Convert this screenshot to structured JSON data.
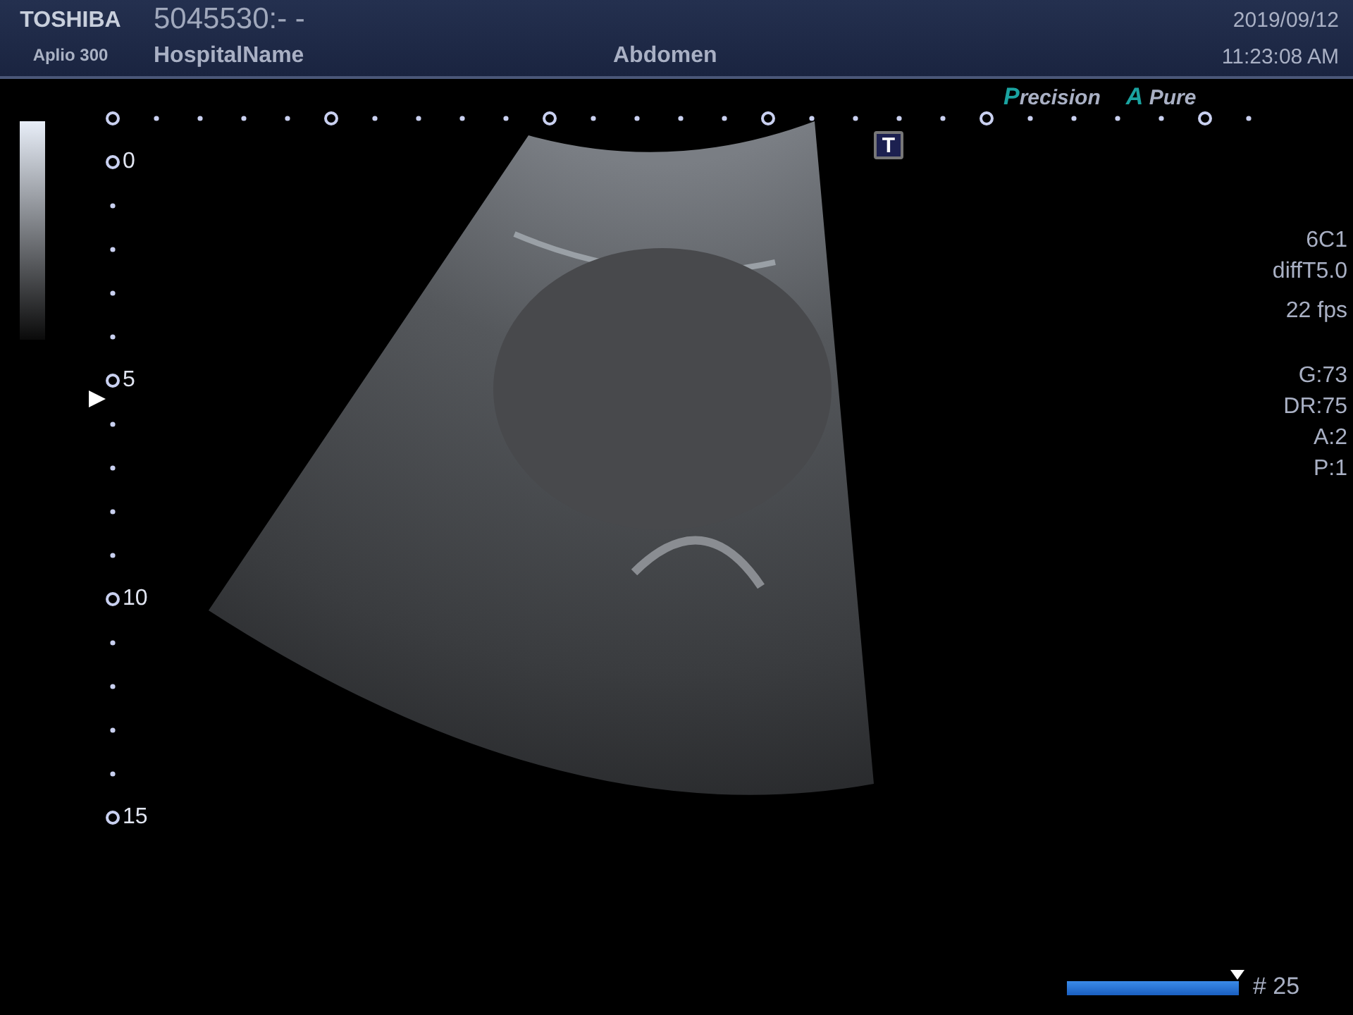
{
  "header": {
    "brand": "TOSHIBA",
    "model": "Aplio 300",
    "patient_id": "5045530:- -",
    "hospital": "HospitalName",
    "exam": "Abdomen",
    "date": "2019/09/12",
    "time": "11:23:08 AM"
  },
  "modes": [
    "Precision",
    "A Pure"
  ],
  "t_badge": "T",
  "depth_labels": [
    "0",
    "5",
    "10",
    "15"
  ],
  "parameter_groups": [
    [
      "6C1",
      "diffT5.0"
    ],
    [
      "22 fps"
    ],
    [
      "G:73",
      "DR:75",
      "A:2",
      "P:1"
    ]
  ],
  "cine": {
    "level": 1,
    "frame": "# 25"
  }
}
